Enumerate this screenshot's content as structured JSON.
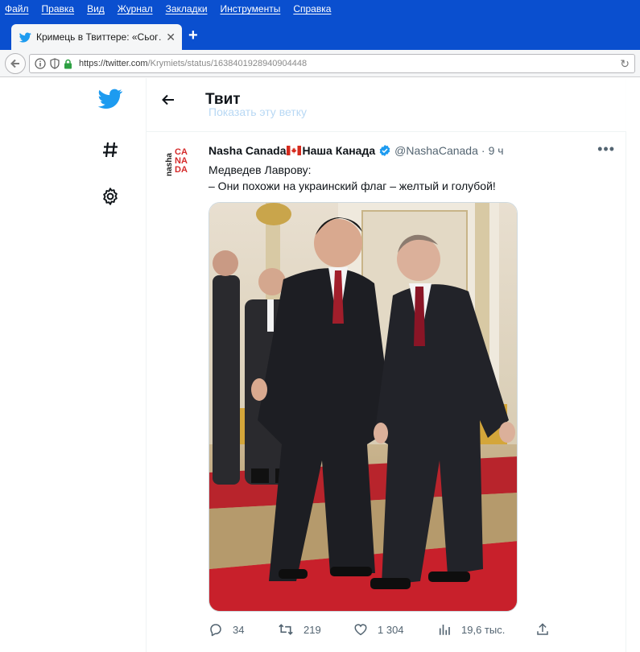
{
  "browser": {
    "menu": [
      "Файл",
      "Правка",
      "Вид",
      "Журнал",
      "Закладки",
      "Инструменты",
      "Справка"
    ],
    "tab_title": "Кримець в Твиттере: «Сьог…",
    "url_host": "https://twitter.com",
    "url_path": "/Krymiets/status/1638401928940904448",
    "accent": "#0a4fcf"
  },
  "nav": {
    "icons": [
      "twitter-bird-icon",
      "hashtag-icon",
      "settings-gear-icon"
    ]
  },
  "header": {
    "title": "Твит",
    "ghost_link": "Показать эту ветку"
  },
  "tweet": {
    "display_name": "Nasha Canada",
    "display_name_2": "Наша Канада",
    "handle": "@NashaCanada",
    "separator": "·",
    "time": "9 ч",
    "text_line1": "Медведев Лаврову:",
    "text_line2": "– Они похожи на украинский флаг – желтый и голубой!",
    "avatar_text": "nasha CANADA",
    "avatar_small": "nasha",
    "avatar_big": "CANADA"
  },
  "actions": {
    "replies": "34",
    "retweets": "219",
    "likes": "1 304",
    "views": "19,6 тыс."
  },
  "colors": {
    "twitter_blue": "#1d9bf0",
    "text": "#0f1419",
    "muted": "#536471",
    "carpet_red": "#c8202b"
  }
}
